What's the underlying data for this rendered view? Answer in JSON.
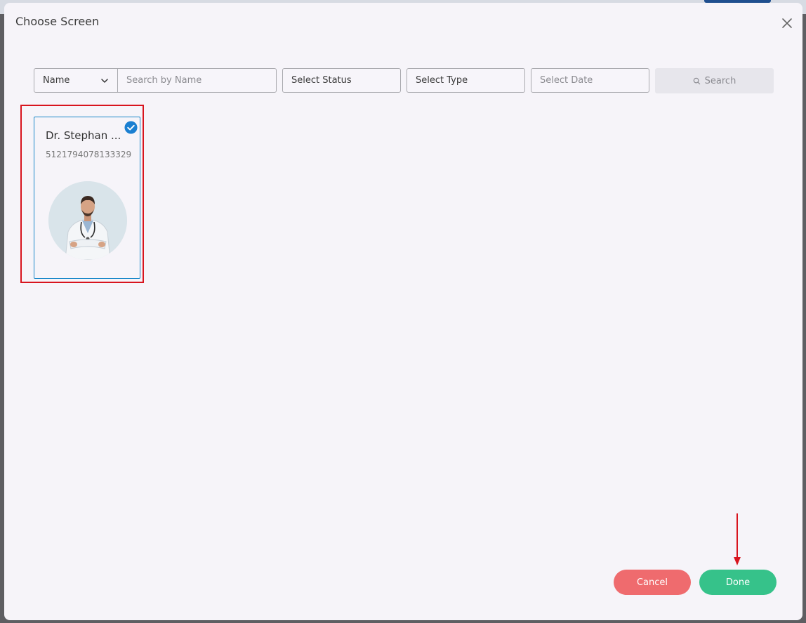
{
  "modal": {
    "title": "Choose Screen"
  },
  "filters": {
    "name_select": "Name",
    "name_placeholder": "Search by Name",
    "status_placeholder": "Select Status",
    "type_placeholder": "Select Type",
    "date_placeholder": "Select Date",
    "search_label": "Search"
  },
  "screens": [
    {
      "name": "Dr. Stephan ...",
      "id": "5121794078133329",
      "selected": true
    }
  ],
  "footer": {
    "cancel_label": "Cancel",
    "done_label": "Done"
  },
  "icons": {
    "close": "close-icon",
    "chevron": "chevron-down-icon",
    "search": "search-icon",
    "check": "check-circle-icon"
  },
  "colors": {
    "accent_blue": "#1a88c9",
    "highlight_red": "#d8141e",
    "cancel": "#ef6b6e",
    "done": "#36c28a"
  }
}
